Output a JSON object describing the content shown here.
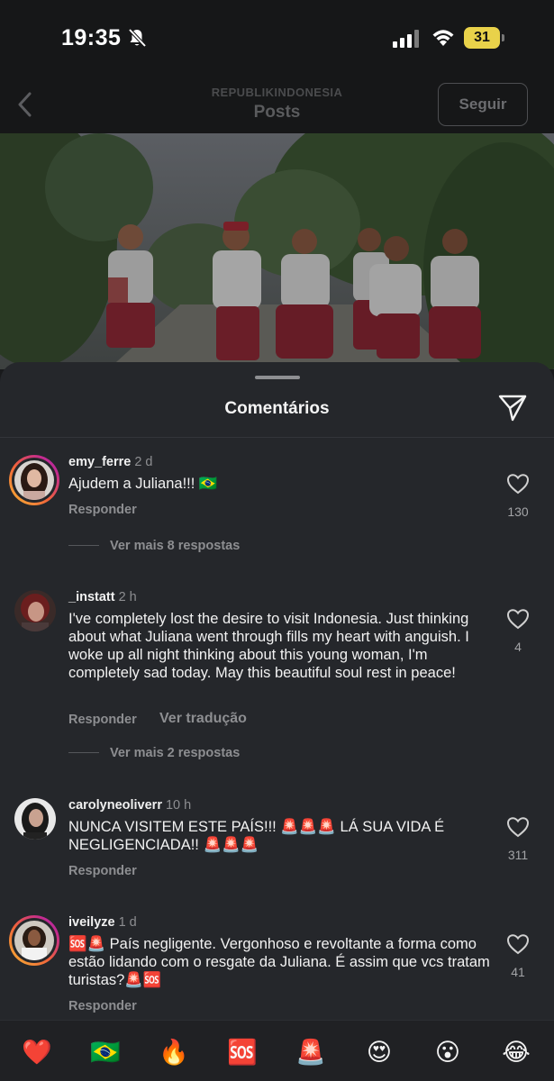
{
  "status_bar": {
    "time": "19:35",
    "battery": "31"
  },
  "nav": {
    "account": "REPUBLIKINDONESIA",
    "title": "Posts",
    "follow_label": "Seguir"
  },
  "sheet": {
    "title": "Comentários"
  },
  "comments": [
    {
      "username": "emy_ferre",
      "time": "2 d",
      "text": "Ajudem a Juliana!!! 🇧🇷",
      "reply_label": "Responder",
      "likes": "130",
      "more_replies": "Ver mais 8 respostas"
    },
    {
      "username": "_instatt",
      "time": "2 h",
      "text": "I've completely lost the desire to visit Indonesia. Just thinking about what Juliana went through fills my heart with anguish. I woke up all night thinking about this young woman, I'm completely sad today. May this beautiful soul rest in peace!",
      "reply_label": "Responder",
      "translate_label": "Ver tradução",
      "likes": "4",
      "more_replies": "Ver mais 2 respostas"
    },
    {
      "username": "carolyneoliverr",
      "time": "10 h",
      "text": "NUNCA VISITEM ESTE PAÍS!!! 🚨🚨🚨 LÁ SUA VIDA É NEGLIGENCIADA!! 🚨🚨🚨",
      "reply_label": "Responder",
      "likes": "311"
    },
    {
      "username": "iveilyze",
      "time": "1 d",
      "text": "🆘🚨 País negligente. Vergonhoso e revoltante a forma como estão lidando com o resgate da Juliana. É assim que vcs tratam turistas?🚨🆘",
      "reply_label": "Responder",
      "likes": "41"
    }
  ],
  "emoji_bar": [
    "❤️",
    "🇧🇷",
    "🔥",
    "🆘",
    "🚨",
    "😍",
    "😮",
    "😂"
  ],
  "icons": {
    "back": "chevron-left-icon",
    "mute": "bell-slash-icon",
    "signal": "cellular-signal-icon",
    "wifi": "wifi-icon",
    "share": "paper-plane-icon",
    "like": "heart-outline-icon"
  },
  "colors": {
    "sheet_background": "#25272b",
    "battery": "#e9d24a",
    "muted_text": "#8d8e91"
  }
}
